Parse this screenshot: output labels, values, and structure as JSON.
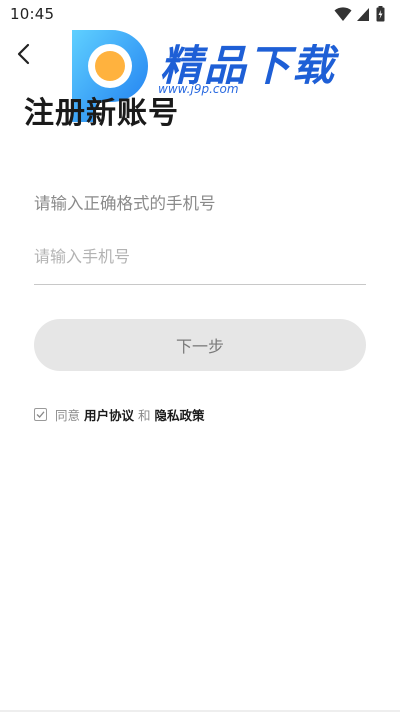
{
  "status_bar": {
    "time": "10:45",
    "icons": [
      "wifi-icon",
      "signal-icon",
      "battery-charging-icon"
    ]
  },
  "nav": {
    "back_icon": "chevron-left-icon"
  },
  "watermark": {
    "brand": "精品下载",
    "url": "www.j9p.com",
    "accent": "#1e5fd6"
  },
  "page": {
    "title": "注册新账号",
    "hint": "请输入正确格式的手机号"
  },
  "form": {
    "phone_placeholder": "请输入手机号",
    "phone_value": "",
    "next_label": "下一步",
    "next_button_bg": "#e6e6e6"
  },
  "agreement": {
    "prefix": "同意",
    "user_agreement": "用户协议",
    "connector": "和",
    "privacy_policy": "隐私政策",
    "checked": true
  }
}
